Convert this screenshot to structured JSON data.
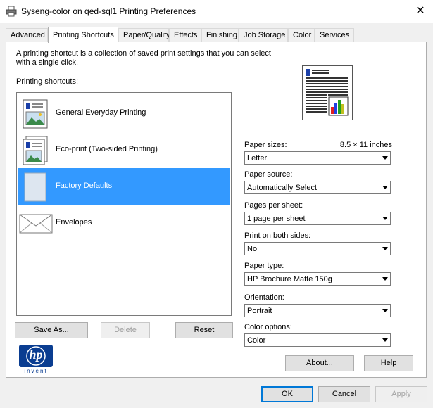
{
  "window": {
    "title": "Syseng-color on qed-sql1 Printing Preferences",
    "close_glyph": "✕"
  },
  "tabs": [
    {
      "label": "Advanced"
    },
    {
      "label": "Printing Shortcuts"
    },
    {
      "label": "Paper/Quality"
    },
    {
      "label": "Effects"
    },
    {
      "label": "Finishing"
    },
    {
      "label": "Job Storage"
    },
    {
      "label": "Color"
    },
    {
      "label": "Services"
    }
  ],
  "shortcuts_panel": {
    "description": "A printing shortcut is a collection of saved print settings that you can select with a single click.",
    "list_label": "Printing shortcuts:",
    "items": [
      {
        "label": "General Everyday Printing",
        "icon": "document-image-icon"
      },
      {
        "label": "Eco-print (Two-sided Printing)",
        "icon": "two-sided-document-icon"
      },
      {
        "label": "Factory Defaults",
        "icon": "blank-page-icon",
        "selected": true
      },
      {
        "label": "Envelopes",
        "icon": "envelope-icon"
      }
    ],
    "buttons": {
      "save_as": "Save As...",
      "delete": "Delete",
      "reset": "Reset"
    }
  },
  "settings": {
    "paper_sizes": {
      "label": "Paper sizes:",
      "dimension": "8.5 × 11 inches",
      "value": "Letter"
    },
    "paper_source": {
      "label": "Paper source:",
      "value": "Automatically Select"
    },
    "pages_per_sheet": {
      "label": "Pages per sheet:",
      "value": "1 page per sheet"
    },
    "print_both_sides": {
      "label": "Print on both sides:",
      "value": "No"
    },
    "paper_type": {
      "label": "Paper type:",
      "value": "HP Brochure Matte 150g"
    },
    "orientation": {
      "label": "Orientation:",
      "value": "Portrait"
    },
    "color_options": {
      "label": "Color options:",
      "value": "Color"
    }
  },
  "panel_buttons": {
    "about": "About...",
    "help": "Help"
  },
  "dialog_buttons": {
    "ok": "OK",
    "cancel": "Cancel",
    "apply": "Apply"
  },
  "logo": {
    "text": "hp",
    "subtext": "invent",
    "color": "#0a3d91"
  },
  "colors": {
    "selection": "#3399ff",
    "accent": "#0078d7"
  }
}
